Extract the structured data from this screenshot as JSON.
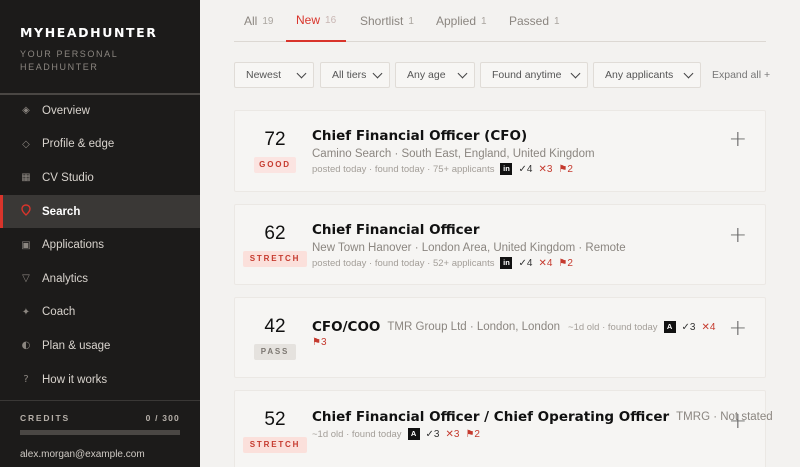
{
  "sidebar": {
    "brand": "MYHEADHUNTER",
    "tagline": "YOUR PERSONAL HEADHUNTER",
    "items": [
      {
        "label": "Overview",
        "icon": "diamond-icon"
      },
      {
        "label": "Profile & edge",
        "icon": "diamond-outline-icon"
      },
      {
        "label": "CV Studio",
        "icon": "square-icon"
      },
      {
        "label": "Search",
        "icon": "location-pin-icon"
      },
      {
        "label": "Applications",
        "icon": "square-outline-icon"
      },
      {
        "label": "Analytics",
        "icon": "triangle-down-icon"
      },
      {
        "label": "Coach",
        "icon": "sparkle-icon"
      },
      {
        "label": "Plan & usage",
        "icon": "half-circle-icon"
      },
      {
        "label": "How it works",
        "icon": "question-icon"
      }
    ],
    "active_index": 3,
    "credits_label": "CREDITS",
    "credits_count": "0 / 300",
    "credits_used_fraction": 0,
    "email": "alex.morgan@example.com"
  },
  "tabs": [
    {
      "label": "All",
      "count": "19"
    },
    {
      "label": "New",
      "count": "16"
    },
    {
      "label": "Shortlist",
      "count": "1"
    },
    {
      "label": "Applied",
      "count": "1"
    },
    {
      "label": "Passed",
      "count": "1"
    }
  ],
  "filters": {
    "sort": "Newest",
    "tier": "All tiers",
    "age": "Any age",
    "found": "Found anytime",
    "applicants": "Any applicants",
    "expand_label": "Expand all +"
  },
  "jobs": [
    {
      "score": "72",
      "tier": "GOOD",
      "title": "Chief Financial Officer (CFO)",
      "company_location": "Camino Search · South East, England, United Kingdom",
      "posted": "posted today · found today · 75+ applicants",
      "source": "in",
      "matches": "✓4",
      "gaps": "✕3",
      "flags": "⚑2"
    },
    {
      "score": "62",
      "tier": "STRETCH",
      "title": "Chief Financial Officer",
      "company_location": "New Town Hanover · London Area, United Kingdom · Remote",
      "posted": "posted today · found today · 52+ applicants",
      "source": "in",
      "matches": "✓4",
      "gaps": "✕4",
      "flags": "⚑2"
    },
    {
      "score": "42",
      "tier": "PASS",
      "title": "CFO/COO",
      "company_location": "TMR Group Ltd · London, London",
      "posted": "~1d old · found today",
      "source": "A",
      "matches": "✓3",
      "gaps": "✕4",
      "flags": "⚑3"
    },
    {
      "score": "52",
      "tier": "STRETCH",
      "title": "Chief Financial Officer / Chief Operating Officer",
      "company_location": "TMRG · Not stated",
      "posted": "~1d old · found today",
      "source": "A",
      "matches": "✓3",
      "gaps": "✕3",
      "flags": "⚑2"
    }
  ],
  "colors": {
    "accent": "#d9342b",
    "sidebar_bg": "#1c1b1a",
    "page_bg": "#f3f2f0"
  }
}
